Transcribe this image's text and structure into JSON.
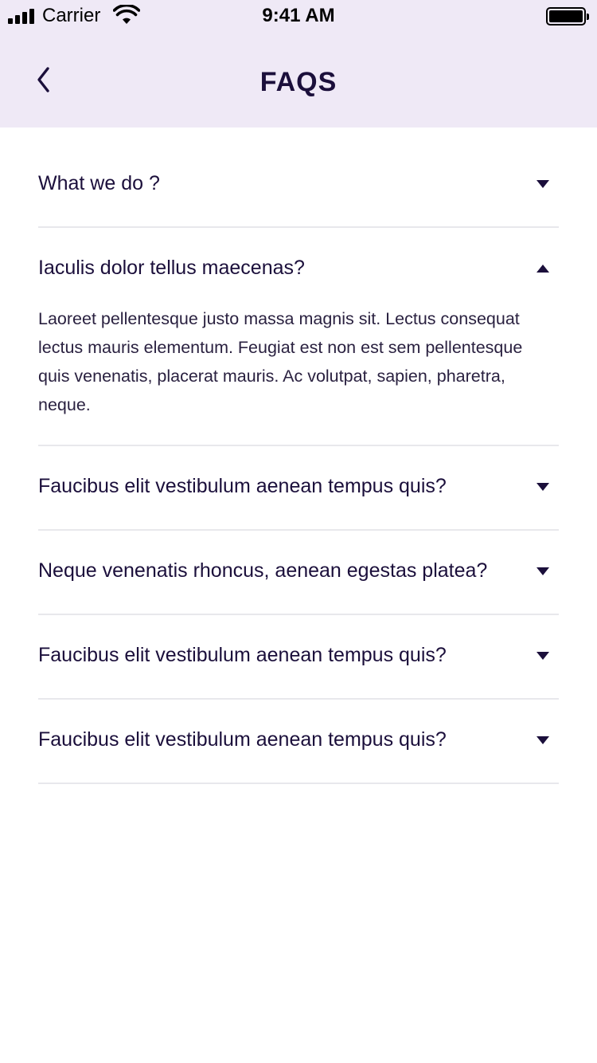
{
  "status_bar": {
    "carrier": "Carrier",
    "time": "9:41 AM"
  },
  "header": {
    "title": "FAQS",
    "back_icon": "chevron-left-icon",
    "background": "#efe9f6"
  },
  "faqs": [
    {
      "question": "What we do ?",
      "expanded": false
    },
    {
      "question": "Iaculis dolor tellus maecenas?",
      "expanded": true,
      "answer": "Laoreet pellentesque justo massa magnis sit. Lectus consequat lectus mauris elementum. Feugiat est non est sem pellentesque quis venenatis, placerat mauris. Ac volutpat, sapien, pharetra, neque."
    },
    {
      "question": "Faucibus elit vestibulum aenean tempus quis?",
      "expanded": false
    },
    {
      "question": "Neque venenatis rhoncus, aenean egestas platea?",
      "expanded": false
    },
    {
      "question": "Faucibus elit vestibulum aenean tempus quis?",
      "expanded": false
    },
    {
      "question": "Faucibus elit vestibulum aenean tempus quis?",
      "expanded": false
    }
  ],
  "colors": {
    "text": "#1b0f3b",
    "divider": "#e8e8ec"
  }
}
